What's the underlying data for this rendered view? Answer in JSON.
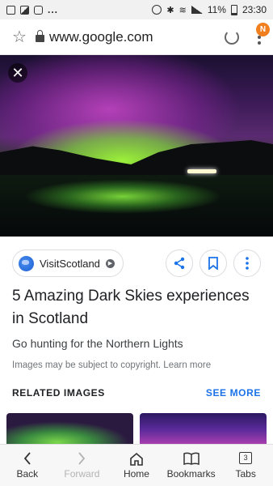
{
  "status_bar": {
    "notifications": [
      "image-notification-icon",
      "photo-notification-icon",
      "message-notification-icon"
    ],
    "overflow": "...",
    "battery": "11%",
    "time": "23:30"
  },
  "browser": {
    "url": "www.google.com",
    "menu_badge": "N",
    "badge_color": "#f07f1e"
  },
  "image_viewer": {
    "source": "VisitScotland",
    "title": "5 Amazing Dark Skies experiences in Scotland",
    "subtitle": "Go hunting for the Northern Lights",
    "copyright_text": "Images may be subject to copyright.",
    "learn_more": "Learn more",
    "related_header": "RELATED IMAGES",
    "see_more": "SEE MORE",
    "accent_color": "#1a73e8"
  },
  "bottom_nav": {
    "back": "Back",
    "forward": "Forward",
    "home": "Home",
    "bookmarks": "Bookmarks",
    "tabs": "Tabs",
    "tab_count": "3"
  }
}
